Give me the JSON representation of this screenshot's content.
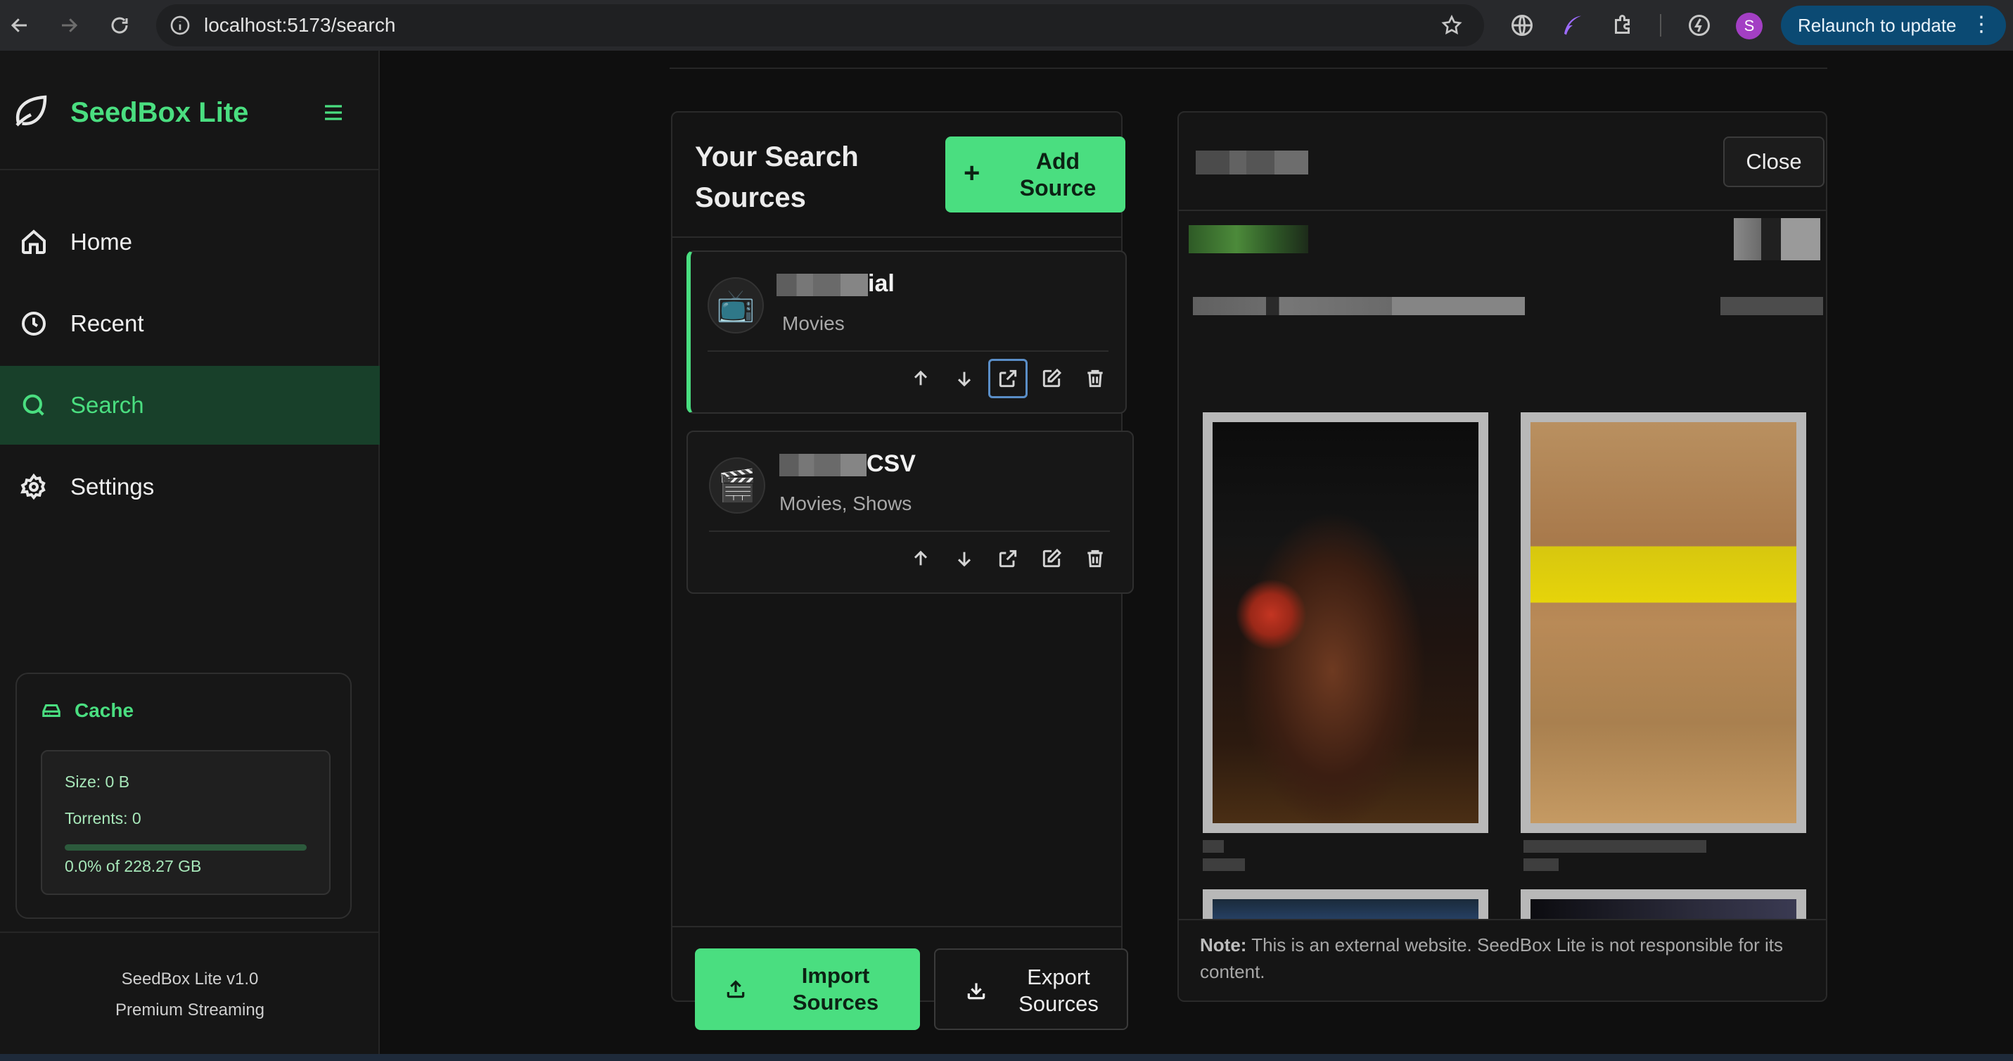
{
  "browser": {
    "url": "localhost:5173/search",
    "avatar_letter": "S",
    "relaunch_label": "Relaunch to update"
  },
  "sidebar": {
    "brand": "SeedBox Lite",
    "nav": [
      {
        "label": "Home",
        "icon": "home-icon"
      },
      {
        "label": "Recent",
        "icon": "clock-icon"
      },
      {
        "label": "Search",
        "icon": "search-icon",
        "active": true
      },
      {
        "label": "Settings",
        "icon": "gear-icon"
      }
    ],
    "cache": {
      "title": "Cache",
      "size": "Size: 0 B",
      "torrents": "Torrents: 0",
      "usage": "0.0% of 228.27 GB",
      "usage_fraction": 0.0
    },
    "footer": {
      "version": "SeedBox Lite v1.0",
      "tagline": "Premium Streaming"
    }
  },
  "sources_panel": {
    "title": "Your Search Sources",
    "add_button": "Add Source",
    "sources": [
      {
        "name_suffix": "ial",
        "icon": "📺",
        "categories": "Movies",
        "selected": true
      },
      {
        "name_suffix": "csv",
        "icon": "🎬",
        "categories": "Movies, Shows",
        "selected": false
      }
    ],
    "import_button": "Import Sources",
    "export_button": "Export Sources"
  },
  "preview": {
    "close_button": "Close",
    "note_label": "Note:",
    "note_text": " This is an external website. SeedBox Lite is not responsible for its content."
  },
  "colors": {
    "accent": "#4ade80",
    "active_bg": "#18402a",
    "relaunch_bg": "#0b4a73"
  }
}
